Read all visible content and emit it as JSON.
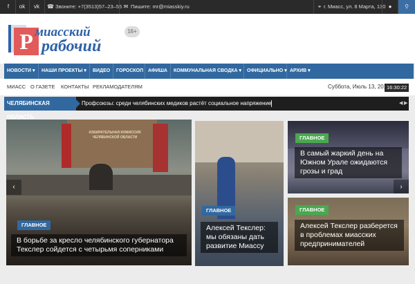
{
  "topbar": {
    "phone": "Звоните: +7(3513)57–23–55",
    "email": "Пишите: mr@miasskiy.ru",
    "address": "г. Миасс, ул. 8 Марта, 130",
    "icons": [
      "facebook-icon",
      "odnoklassniki-icon",
      "vk-icon",
      "phone-icon",
      "envelope-icon",
      "map-marker-icon",
      "user-icon",
      "search-icon"
    ]
  },
  "logo": {
    "line1": "миасский",
    "line2": "рабочий",
    "letter": "Р",
    "age": "16+"
  },
  "nav": {
    "items": [
      {
        "label": "НОВОСТИ ▾"
      },
      {
        "label": "НАШИ ПРОЕКТЫ ▾"
      },
      {
        "label": "ВИДЕО"
      },
      {
        "label": "ГОРОСКОП"
      },
      {
        "label": "АФИША"
      },
      {
        "label": "КОММУНАЛЬНАЯ СВОДКА ▾"
      },
      {
        "label": "ОФИЦИАЛЬНО ▾"
      },
      {
        "label": "АРХИВ ▾"
      }
    ]
  },
  "subnav": {
    "links": [
      "МИАСС",
      "О ГАЗЕТЕ",
      "КОНТАКТЫ",
      "РЕКЛАМОДАТЕЛЯМ"
    ],
    "date": "Суббота, Июль 13, 2019",
    "time": "16:30:22"
  },
  "ticker": {
    "tag": "ЧЕЛЯБИНСКАЯ ОБЛАСТЬ",
    "message": "Профсоюзы: среди челябинских медиков растёт социальное напряжение"
  },
  "slides": [
    {
      "badge": "ГЛАВНОЕ",
      "title_lines": [
        "В борьбе за кресло челябинского губернатора",
        "Текслер сойдется с четырьмя соперниками"
      ],
      "badge_color": "#31689f",
      "banner": "ИЗБИРАТЕЛЬНАЯ КОМИССИЯ ЧЕЛЯБИНСКОЙ ОБЛАСТИ"
    },
    {
      "badge": "ГЛАВНОЕ",
      "title_lines": [
        "Алексей Текслер:",
        "мы обязаны дать",
        "развитие Миассу"
      ],
      "badge_color": "#31689f"
    },
    {
      "badge": "ГЛАВНОЕ",
      "title_lines": [
        "В самый жаркий день на",
        "Южном Урале ожидаются",
        "грозы и град"
      ],
      "badge_color": "#4aa84f"
    },
    {
      "badge": "ГЛАВНОЕ",
      "title_lines": [
        "Алексей Текслер разберется",
        "в проблемах миасских",
        "предпринимателей"
      ],
      "badge_color": "#4aa84f"
    }
  ],
  "arrows": {
    "prev": "‹",
    "next": "›"
  }
}
